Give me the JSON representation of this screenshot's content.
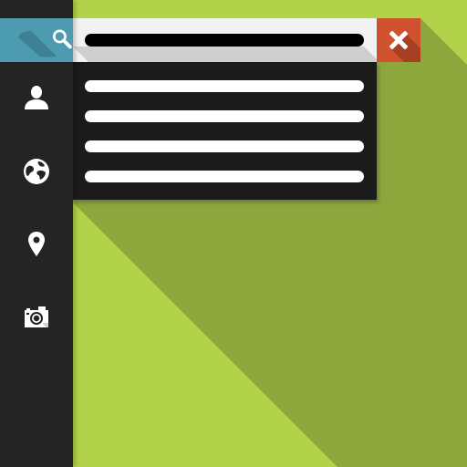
{
  "colors": {
    "background": "#b1d249",
    "long_shadow": "#8ea73d",
    "sidebar": "#242424",
    "search_accent": "#4c9bb0",
    "close_accent": "#d0512e",
    "dropdown": "#1b1b1b",
    "search_bar": "#f2f2f2"
  },
  "sidebar": {
    "items": [
      {
        "icon": "search-icon",
        "active": true
      },
      {
        "icon": "user-icon",
        "active": false
      },
      {
        "icon": "globe-icon",
        "active": false
      },
      {
        "icon": "map-pin-icon",
        "active": false
      },
      {
        "icon": "camera-icon",
        "active": false
      }
    ]
  },
  "search": {
    "value": "",
    "placeholder": ""
  },
  "close_button": {
    "icon": "close-icon"
  },
  "dropdown": {
    "results": [
      {
        "text": ""
      },
      {
        "text": ""
      },
      {
        "text": ""
      },
      {
        "text": ""
      }
    ]
  }
}
